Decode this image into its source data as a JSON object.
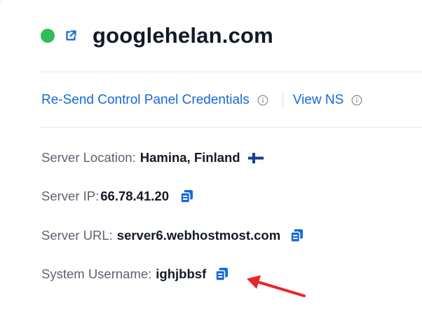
{
  "header": {
    "status_color": "#2ebd59",
    "domain": "googlehelan.com",
    "external_icon": "external-link-icon"
  },
  "actions": {
    "resend_label": "Re-Send Control Panel Credentials",
    "view_ns_label": "View NS",
    "info_icon": "info-icon"
  },
  "details": {
    "location_label": "Server Location:",
    "location_value": "Hamina, Finland",
    "location_flag": "finland-flag-icon",
    "ip_label": "Server IP:",
    "ip_value": "66.78.41.20",
    "url_label": "Server URL:",
    "url_value": "server6.webhostmost.com",
    "username_label": "System Username:",
    "username_value": "ighjbbsf",
    "copy_icon": "copy-icon"
  },
  "colors": {
    "link": "#1668dc",
    "annotation_arrow": "#e8252a"
  }
}
